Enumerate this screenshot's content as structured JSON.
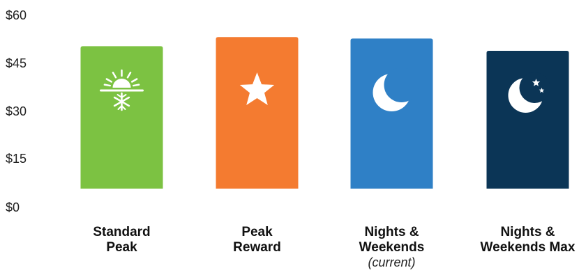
{
  "chart_data": {
    "type": "bar",
    "categories": [
      [
        "Standard",
        "Peak"
      ],
      [
        "Peak",
        "Reward"
      ],
      [
        "Nights &",
        "Weekends"
      ],
      [
        "Nights &",
        "Weekends Max"
      ]
    ],
    "category_notes": [
      "",
      "",
      "(current)",
      ""
    ],
    "values": [
      46.5,
      49.5,
      49,
      45
    ],
    "colors": [
      "#7cc242",
      "#f47b30",
      "#2f80c6",
      "#0b3556"
    ],
    "icons": [
      "sun-snowflake-icon",
      "star-icon",
      "moon-icon",
      "moon-stars-icon"
    ],
    "y_ticks": [
      "$0",
      "$15",
      "$30",
      "$45",
      "$60"
    ],
    "y_tick_values": [
      0,
      15,
      30,
      45,
      60
    ],
    "ylim": [
      0,
      60
    ],
    "grid": false,
    "legend": "none"
  }
}
